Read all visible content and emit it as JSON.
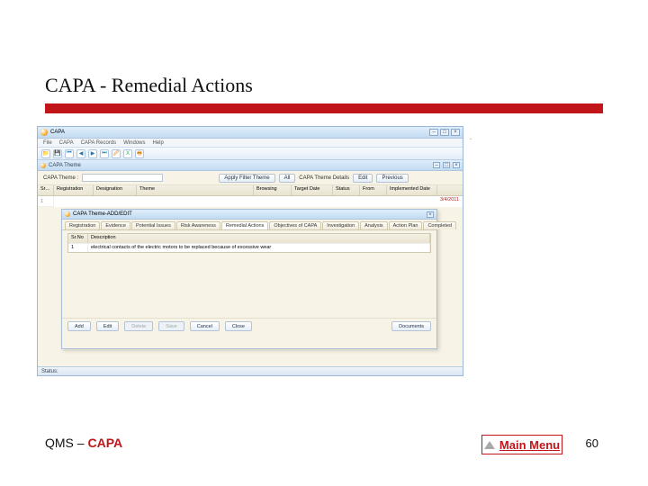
{
  "slide": {
    "title": "CAPA - Remedial Actions",
    "annotation": "."
  },
  "footer": {
    "prefix": "QMS – ",
    "module": "CAPA",
    "mainMenuLabel": "Main Menu",
    "pageNumber": "60"
  },
  "app": {
    "title": "CAPA",
    "menus": [
      "File",
      "CAPA",
      "CAPA Records",
      "Windows",
      "Help"
    ],
    "toolbarIcons": [
      "folder",
      "save",
      "arrow-first",
      "arrow-prev",
      "arrow-next",
      "arrow-last",
      "edit",
      "excel",
      "print"
    ],
    "child": {
      "title": "CAPA Theme"
    },
    "filter": {
      "labelTheme": "CAPA Theme :",
      "themeValue": "",
      "applyFilterBtn": "Apply Filter Theme",
      "allBtn": "All",
      "labelDetails": "CAPA Theme Details",
      "editBtn": "Edit",
      "previousBtn": "Previous"
    },
    "grid": {
      "columns": [
        "Sr.No",
        "Registration",
        "Designation",
        "Theme",
        "Browsing",
        "Target Date",
        "Status",
        "From",
        "Implemented Date"
      ],
      "rowNum": "1",
      "implDate": "3/4/2011"
    },
    "dialog": {
      "title": "CAPA Theme-ADD/EDIT",
      "tabs": [
        "Registration",
        "Evidence",
        "Potential Issues",
        "Risk Awareness",
        "Remedial Actions",
        "Objectives of CAPA",
        "Investigation",
        "Analysis",
        "Action Plan",
        "Completed"
      ],
      "activeTab": "Remedial Actions",
      "descCols": [
        "Sr.No",
        "Description"
      ],
      "descRow": {
        "sr": "1",
        "desc": "electrical contacts of the electric motors to be replaced because of excessive wear"
      },
      "buttons": {
        "add": "Add",
        "edit": "Edit",
        "delete": "Delete",
        "save": "Save",
        "cancel": "Cancel",
        "close": "Close",
        "documents": "Documents"
      }
    },
    "statusbar": "Status:"
  }
}
